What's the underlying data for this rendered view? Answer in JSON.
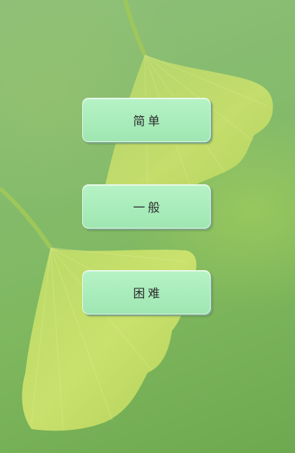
{
  "background": {
    "description_icon": "ginkgo-leaf-background",
    "colors": {
      "base": "#84bb6c",
      "leaf": "#c8e06a"
    }
  },
  "menu": {
    "buttons": [
      {
        "id": "easy",
        "label": "简单"
      },
      {
        "id": "normal",
        "label": "一般"
      },
      {
        "id": "hard",
        "label": "困难"
      }
    ]
  },
  "button_color": "#a9ecbb"
}
